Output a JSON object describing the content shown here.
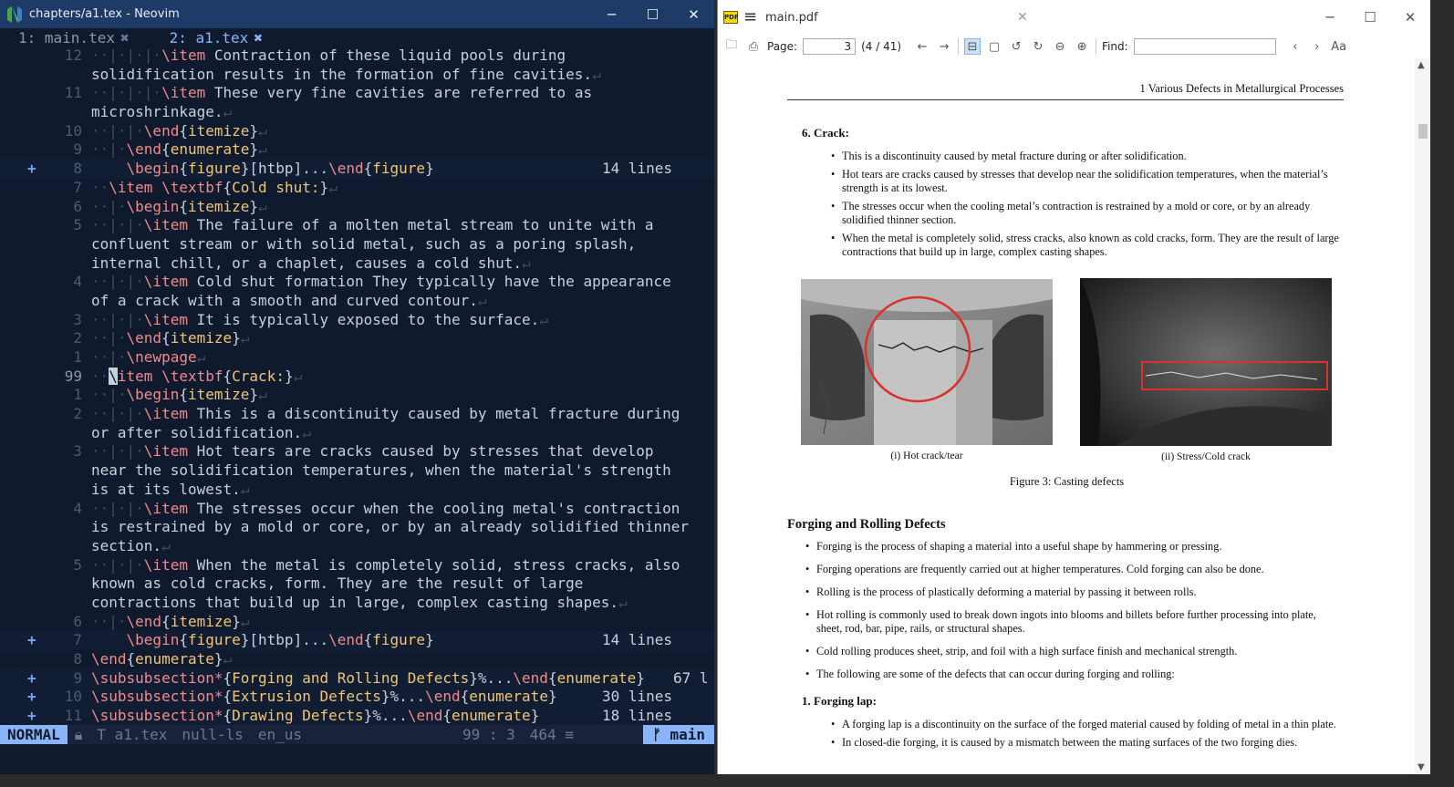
{
  "nvim": {
    "title": "chapters/a1.tex - Neovim",
    "tabs": [
      {
        "label": "1: main.tex",
        "close": "✖"
      },
      {
        "label": "2: a1.tex",
        "close": "✖"
      }
    ],
    "lines": [
      {
        "num": "12",
        "code": "··|·|·|·\\item Contraction of these liquid pools during"
      },
      {
        "num": "",
        "code": "solidification results in the formation of fine cavities.↵"
      },
      {
        "num": "11",
        "code": "··|·|·|·\\item These very fine cavities are referred to as"
      },
      {
        "num": "",
        "code": "microshrinkage.↵"
      },
      {
        "num": "10",
        "code": "··|·|·\\end{itemize}↵"
      },
      {
        "num": "9",
        "code": "··|·\\end{enumerate}↵"
      },
      {
        "num": "8",
        "code": "    \\begin{figure}[htbp]...\\end{figure}",
        "fold": "14 lines",
        "sign": "+"
      },
      {
        "num": "7",
        "code": "··\\item \\textbf{Cold shut:}↵"
      },
      {
        "num": "6",
        "code": "··|·\\begin{itemize}↵"
      },
      {
        "num": "5",
        "code": "··|·|·\\item The failure of a molten metal stream to unite with a"
      },
      {
        "num": "",
        "code": "confluent stream or with solid metal, such as a poring splash,"
      },
      {
        "num": "",
        "code": "internal chill, or a chaplet, causes a cold shut.↵"
      },
      {
        "num": "4",
        "code": "··|·|·\\item Cold shut formation They typically have the appearance"
      },
      {
        "num": "",
        "code": "of a crack with a smooth and curved contour.↵"
      },
      {
        "num": "3",
        "code": "··|·|·\\item It is typically exposed to the surface.↵"
      },
      {
        "num": "2",
        "code": "··|·\\end{itemize}↵"
      },
      {
        "num": "1",
        "code": "··|·\\newpage↵"
      },
      {
        "num": "99",
        "code": "··\\item \\textbf{Crack:}↵",
        "current": true
      },
      {
        "num": "1",
        "code": "··|·\\begin{itemize}↵"
      },
      {
        "num": "2",
        "code": "··|·|·\\item This is a discontinuity caused by metal fracture during"
      },
      {
        "num": "",
        "code": "or after solidification.↵"
      },
      {
        "num": "3",
        "code": "··|·|·\\item Hot tears are cracks caused by stresses that develop"
      },
      {
        "num": "",
        "code": "near the solidification temperatures, when the material's strength"
      },
      {
        "num": "",
        "code": "is at its lowest.↵"
      },
      {
        "num": "4",
        "code": "··|·|·\\item The stresses occur when the cooling metal's contraction"
      },
      {
        "num": "",
        "code": "is restrained by a mold or core, or by an already solidified thinner"
      },
      {
        "num": "",
        "code": "section.↵"
      },
      {
        "num": "5",
        "code": "··|·|·\\item When the metal is completely solid, stress cracks, also"
      },
      {
        "num": "",
        "code": "known as cold cracks, form. They are the result of large"
      },
      {
        "num": "",
        "code": "contractions that build up in large, complex casting shapes.↵"
      },
      {
        "num": "6",
        "code": "··|·\\end{itemize}↵"
      },
      {
        "num": "7",
        "code": "    \\begin{figure}[htbp]...\\end{figure}",
        "fold": "14 lines",
        "sign": "+"
      },
      {
        "num": "8",
        "code": "\\end{enumerate}↵"
      },
      {
        "num": "9",
        "code": "\\subsubsection*{Forging and Rolling Defects}%...\\end{enumerate}",
        "fold": "67 l",
        "sign": "+",
        "foldnear": true
      },
      {
        "num": "10",
        "code": "\\subsubsection*{Extrusion Defects}%...\\end{enumerate}",
        "fold": "30 lines",
        "sign": "+"
      },
      {
        "num": "11",
        "code": "\\subsubsection*{Drawing Defects}%...\\end{enumerate}",
        "fold": "18 lines",
        "sign": "+"
      }
    ],
    "status": {
      "mode": "NORMAL",
      "file": "T a1.tex",
      "lsp": "null-ls",
      "spell": "en_us",
      "position": "99 : 3",
      "total": "464 ≡",
      "branch": "ᚠ main"
    }
  },
  "pdf": {
    "tab_title": "main.pdf",
    "page_label": "Page:",
    "page_value": "3",
    "page_count": "(4 / 41)",
    "find_label": "Find:",
    "find_value": "",
    "header": "1   Various Defects in Metallurgical Processes",
    "crack_heading": "6.  Crack:",
    "crack_bullets": [
      "This is a discontinuity caused by metal fracture during or after solidification.",
      "Hot tears are cracks caused by stresses that develop near the solidification temperatures, when the material’s strength is at its lowest.",
      "The stresses occur when the cooling metal’s contraction is restrained by a mold or core, or by an already solidified thinner section.",
      "When the metal is completely solid, stress cracks, also known as cold cracks, form. They are the result of large contractions that build up in large, complex casting shapes."
    ],
    "subcap_a": "(i) Hot crack/tear",
    "subcap_b": "(ii) Stress/Cold crack",
    "figure_caption": "Figure 3: Casting defects",
    "forging_heading": "Forging and Rolling Defects",
    "forging_bullets": [
      "Forging is the process of shaping a material into a useful shape by hammering or pressing.",
      "Forging operations are frequently carried out at higher temperatures. Cold forging can also be done.",
      "Rolling is the process of plastically deforming a material by passing it between rolls.",
      "Hot rolling is commonly used to break down ingots into blooms and billets before further processing into plate, sheet, rod, bar, pipe, rails, or structural shapes.",
      "Cold rolling produces sheet, strip, and foil with a high surface finish and mechanical strength.",
      "The following are some of the defects that can occur during forging and rolling:"
    ],
    "lap_heading": "1.  Forging lap:",
    "lap_bullets": [
      "A forging lap is a discontinuity on the surface of the forged material caused by folding of metal in a thin plate.",
      "In closed-die forging, it is caused by a mismatch between the mating surfaces of the two forging dies."
    ]
  },
  "colors": {
    "nvim_bg": "#0f1a2e",
    "nvim_title": "#1e3a66",
    "accent": "#8ab4f8",
    "keyword": "#f38a8a",
    "arg": "#f0c674",
    "highlight_red": "#d9312b"
  }
}
